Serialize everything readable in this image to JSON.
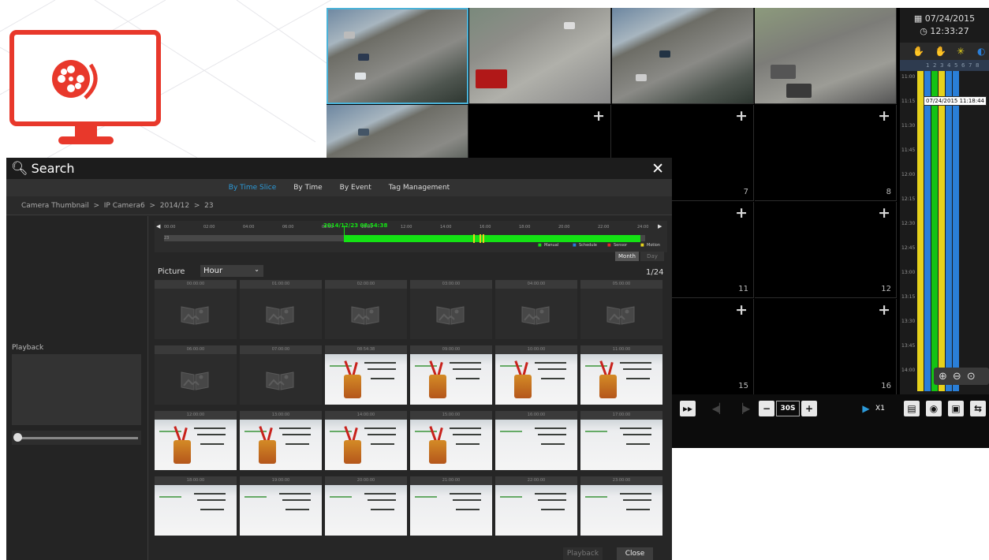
{
  "colors": {
    "logo_red": "#e8382b",
    "nvr_accent": "#4ab2d8",
    "link_blue": "#2c9ad9",
    "timeline_green": "#14e214"
  },
  "nvr": {
    "date": "07/24/2015",
    "time": "12:33:27",
    "timeline_columns": [
      "1",
      "2",
      "3",
      "4",
      "5",
      "6",
      "7",
      "8"
    ],
    "timeline_times": [
      "11:00",
      "11:15",
      "11:30",
      "11:45",
      "12:00",
      "12:15",
      "12:30",
      "12:45",
      "13:00",
      "13:15",
      "13:30",
      "13:45",
      "14:00"
    ],
    "tooltip": "07/24/2015 11:18:44",
    "channel_numbers": {
      "c7": "7",
      "c8": "8",
      "c11": "11",
      "c12": "12",
      "c15": "15",
      "c16": "16"
    },
    "controls": {
      "seek": "30S",
      "speed": "X1"
    }
  },
  "search": {
    "title": "Search",
    "tabs": [
      "By Time Slice",
      "By Time",
      "By Event",
      "Tag Management"
    ],
    "breadcrumb": "Camera Thumbnail  >  IP Camera6  >  2014/12  >  23",
    "playback_label": "Playback",
    "timeline": {
      "current": "2014/12/23  08:54:38",
      "hours": [
        "00:00",
        "02:00",
        "04:00",
        "06:00",
        "08:00",
        "10:00",
        "12:00",
        "14:00",
        "16:00",
        "18:00",
        "20:00",
        "22:00",
        "24:00"
      ],
      "row_label": "23",
      "legend": [
        "Manual",
        "Schedule",
        "Sensor",
        "Motion"
      ]
    },
    "view_buttons": [
      "Month",
      "Day"
    ],
    "picture_label": "Picture",
    "interval": "Hour",
    "page": "1/24",
    "thumbnails": [
      "00:00:00",
      "01:00:00",
      "02:00:00",
      "03:00:00",
      "04:00:00",
      "05:00:00",
      "06:00:00",
      "07:00:00",
      "08:54:38",
      "09:00:00",
      "10:00:00",
      "11:00:00",
      "12:00:00",
      "13:00:00",
      "14:00:00",
      "15:00:00",
      "16:00:00",
      "17:00:00",
      "18:00:00",
      "19:00:00",
      "20:00:00",
      "21:00:00",
      "22:00:00",
      "23:00:00"
    ],
    "buttons": {
      "playback": "Playback",
      "close": "Close"
    }
  }
}
